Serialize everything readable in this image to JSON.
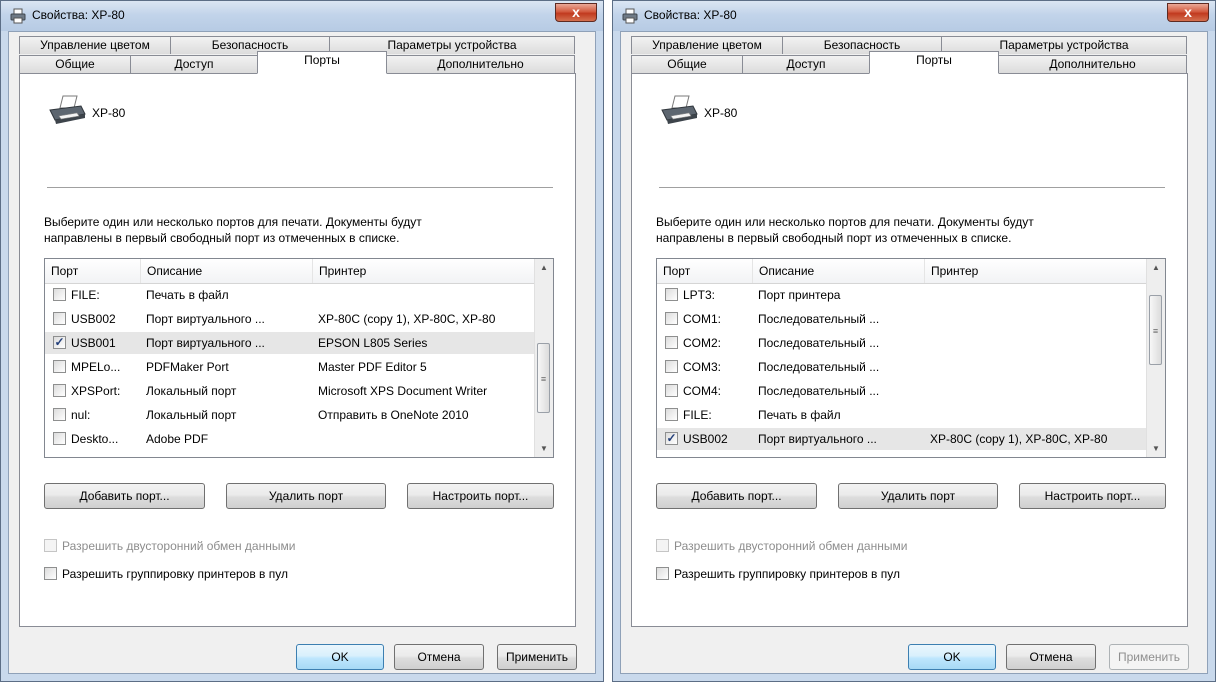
{
  "dialogs": [
    {
      "title": "Свойства: XP-80",
      "close_label": "x",
      "tabs_back": [
        "Управление цветом",
        "Безопасность",
        "Параметры устройства"
      ],
      "tabs_front": [
        "Общие",
        "Доступ",
        "Порты",
        "Дополнительно"
      ],
      "active_tab": "Порты",
      "printer_name": "XP-80",
      "description": [
        "Выберите один или несколько портов для печати. Документы будут",
        "направлены в первый свободный порт из отмеченных в списке."
      ],
      "columns": [
        "Порт",
        "Описание",
        "Принтер"
      ],
      "rows": [
        {
          "checked": false,
          "port": "FILE:",
          "description": "Печать в файл",
          "printer": ""
        },
        {
          "checked": false,
          "port": "USB002",
          "description": "Порт виртуального ...",
          "printer": "XP-80C (copy 1), XP-80C, XP-80"
        },
        {
          "checked": true,
          "port": "USB001",
          "description": "Порт виртуального ...",
          "printer": "EPSON L805 Series"
        },
        {
          "checked": false,
          "port": "MPELo...",
          "description": "PDFMaker Port",
          "printer": "Master PDF Editor 5"
        },
        {
          "checked": false,
          "port": "XPSPort:",
          "description": "Локальный порт",
          "printer": "Microsoft XPS Document Writer"
        },
        {
          "checked": false,
          "port": "nul:",
          "description": "Локальный порт",
          "printer": "Отправить в OneNote 2010"
        },
        {
          "checked": false,
          "port": "Deskto...",
          "description": "Adobe PDF",
          "printer": ""
        }
      ],
      "selected_row": 2,
      "scroll_position": 0.72,
      "port_buttons": [
        "Добавить порт...",
        "Удалить порт",
        "Настроить порт..."
      ],
      "options": [
        {
          "label": "Разрешить двусторонний обмен данными",
          "disabled": true
        },
        {
          "label": "Разрешить группировку принтеров в пул",
          "disabled": false
        }
      ],
      "footer_buttons": {
        "ok": "OK",
        "cancel": "Отмена",
        "apply": "Применить"
      },
      "apply_enabled": true
    },
    {
      "title": "Свойства: XP-80",
      "close_label": "x",
      "tabs_back": [
        "Управление цветом",
        "Безопасность",
        "Параметры устройства"
      ],
      "tabs_front": [
        "Общие",
        "Доступ",
        "Порты",
        "Дополнительно"
      ],
      "active_tab": "Порты",
      "printer_name": "XP-80",
      "description": [
        "Выберите один или несколько портов для печати. Документы будут",
        "направлены в первый свободный порт из отмеченных в списке."
      ],
      "columns": [
        "Порт",
        "Описание",
        "Принтер"
      ],
      "rows": [
        {
          "checked": false,
          "port": "LPT3:",
          "description": "Порт принтера",
          "printer": ""
        },
        {
          "checked": false,
          "port": "COM1:",
          "description": "Последовательный ...",
          "printer": ""
        },
        {
          "checked": false,
          "port": "COM2:",
          "description": "Последовательный ...",
          "printer": ""
        },
        {
          "checked": false,
          "port": "COM3:",
          "description": "Последовательный ...",
          "printer": ""
        },
        {
          "checked": false,
          "port": "COM4:",
          "description": "Последовательный ...",
          "printer": ""
        },
        {
          "checked": false,
          "port": "FILE:",
          "description": "Печать в файл",
          "printer": ""
        },
        {
          "checked": true,
          "port": "USB002",
          "description": "Порт виртуального ...",
          "printer": "XP-80C (copy 1), XP-80C, XP-80"
        }
      ],
      "selected_row": 6,
      "scroll_position": 0.2,
      "port_buttons": [
        "Добавить порт...",
        "Удалить порт",
        "Настроить порт..."
      ],
      "options": [
        {
          "label": "Разрешить двусторонний обмен данными",
          "disabled": true
        },
        {
          "label": "Разрешить группировку принтеров в пул",
          "disabled": false
        }
      ],
      "footer_buttons": {
        "ok": "OK",
        "cancel": "Отмена",
        "apply": "Применить"
      },
      "apply_enabled": false
    }
  ]
}
